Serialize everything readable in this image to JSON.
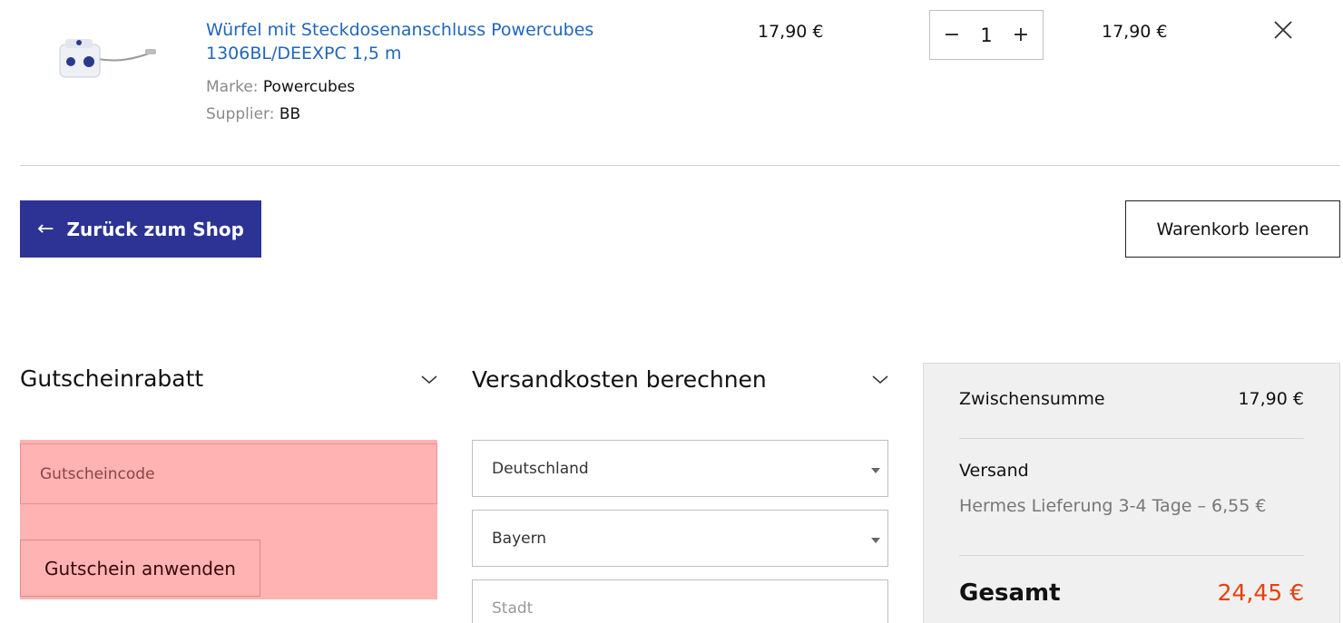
{
  "cart_item": {
    "title_line1": "Würfel mit Steckdosenanschluss Powercubes",
    "title_line2": "1306BL/DEEXPC 1,5 m",
    "brand_label": "Marke:",
    "brand_value": "Powercubes",
    "supplier_label": "Supplier:",
    "supplier_value": "BB",
    "price": "17,90 €",
    "quantity": "1",
    "qty_minus": "−",
    "qty_plus": "+",
    "line_total": "17,90 €",
    "remove_icon": "close-icon"
  },
  "actions": {
    "back_label": "Zurück zum Shop",
    "back_arrow": "←",
    "empty_label": "Warenkorb leeren"
  },
  "coupon": {
    "heading": "Gutscheinrabatt",
    "placeholder": "Gutscheincode",
    "apply_label": "Gutschein anwenden",
    "highlight_color": "#ffb3b3"
  },
  "shipping_calc": {
    "heading": "Versandkosten berechnen",
    "country": "Deutschland",
    "state": "Bayern",
    "city_placeholder": "Stadt"
  },
  "totals": {
    "subtotal_label": "Zwischensumme",
    "subtotal_value": "17,90 €",
    "shipping_label": "Versand",
    "shipping_method": "Hermes Lieferung 3-4 Tage – 6,55 €",
    "total_label": "Gesamt",
    "total_value": "24,45 €",
    "total_color": "#e8400c"
  },
  "colors": {
    "primary": "#2c3395",
    "link": "#2266bb"
  }
}
